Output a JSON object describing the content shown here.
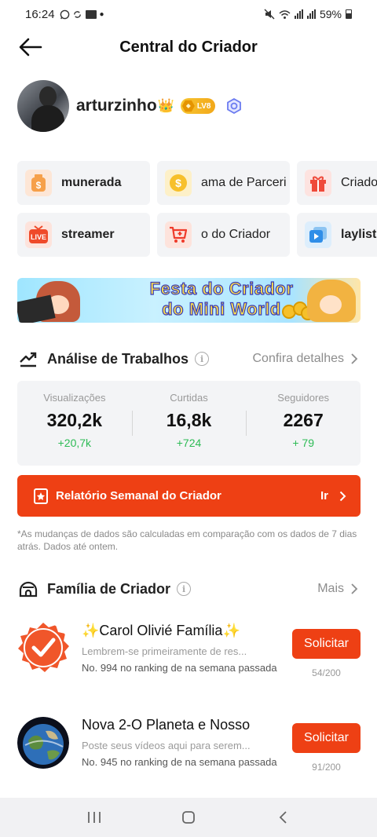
{
  "status_bar": {
    "time": "16:24",
    "battery": "59%"
  },
  "header": {
    "title": "Central do Criador"
  },
  "profile": {
    "username": "arturzinho",
    "crown": "👑",
    "level": "LV8"
  },
  "tools": [
    {
      "label": "munerada",
      "icon": "money-bag-icon"
    },
    {
      "label": "ama de Parceri",
      "icon": "coin-icon"
    },
    {
      "label": "Criado",
      "icon": "gift-icon"
    },
    {
      "label": "streamer",
      "icon": "live-icon"
    },
    {
      "label": "o do Criador",
      "icon": "cart-icon"
    },
    {
      "label": "laylist",
      "icon": "playlist-icon"
    }
  ],
  "banner": {
    "line1": "Festa do Criador",
    "line2": "do Mini World"
  },
  "analysis": {
    "title": "Análise de Trabalhos",
    "link": "Confira detalhes",
    "stats": [
      {
        "label": "Visualizações",
        "value": "320,2k",
        "delta": "+20,7k"
      },
      {
        "label": "Curtidas",
        "value": "16,8k",
        "delta": "+724"
      },
      {
        "label": "Seguidores",
        "value": "2267",
        "delta": "+ 79"
      }
    ]
  },
  "report": {
    "label": "Relatório Semanal do Criador",
    "go": "Ir"
  },
  "note": "*As mudanças de dados são calculadas em comparação com os dados de 7 dias atrás. Dados até ontem.",
  "family_section": {
    "title": "Família de Criador",
    "link": "Mais"
  },
  "families": [
    {
      "name": "✨Carol Olivié Família✨",
      "desc": "Lembrem-se primeiramente de res...",
      "rank": "No. 994 no ranking de na semana passada",
      "button": "Solicitar",
      "count": "54/200"
    },
    {
      "name": "Nova 2-O Planeta e Nosso",
      "desc": "Poste seus vídeos aqui para serem...",
      "rank": "No. 945 no ranking de na semana passada",
      "button": "Solicitar",
      "count": "91/200"
    }
  ]
}
